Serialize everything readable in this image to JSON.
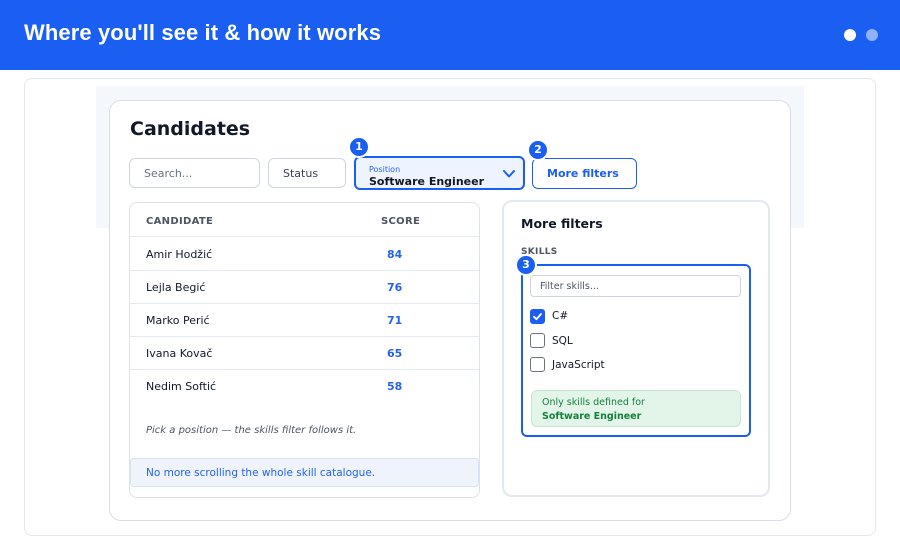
{
  "banner": {
    "title": "Where you'll see it & how it works",
    "dots": 2,
    "active_dot": 1
  },
  "page": {
    "title": "Candidates"
  },
  "filters": {
    "search_placeholder": "Search...",
    "status_label": "Status",
    "position_caption": "Position",
    "position_value": "Software Engineer",
    "more_filters_label": "More filters"
  },
  "badges": [
    "1",
    "2",
    "3"
  ],
  "table": {
    "columns": [
      "CANDIDATE",
      "SCORE"
    ],
    "rows": [
      {
        "name": "Amir Hodžić",
        "score": "84"
      },
      {
        "name": "Lejla Begić",
        "score": "76"
      },
      {
        "name": "Marko Perić",
        "score": "71"
      },
      {
        "name": "Ivana Kovač",
        "score": "65"
      },
      {
        "name": "Nedim Softić",
        "score": "58"
      }
    ],
    "hint": "Pick a position — the skills filter follows it.",
    "info": "No more scrolling the whole skill catalogue."
  },
  "more_filters": {
    "title": "More filters",
    "skills_label": "SKILLS",
    "skill_filter_placeholder": "Filter skills...",
    "skills": [
      {
        "label": "C#",
        "checked": true
      },
      {
        "label": "SQL",
        "checked": false
      },
      {
        "label": "JavaScript",
        "checked": false
      }
    ],
    "note_line1": "Only skills defined for",
    "note_line2": "Software Engineer"
  },
  "colors": {
    "accent": "#1a5ff2",
    "score": "#2563eb",
    "note_bg": "#e3f5e9",
    "note_text": "#15803d"
  }
}
